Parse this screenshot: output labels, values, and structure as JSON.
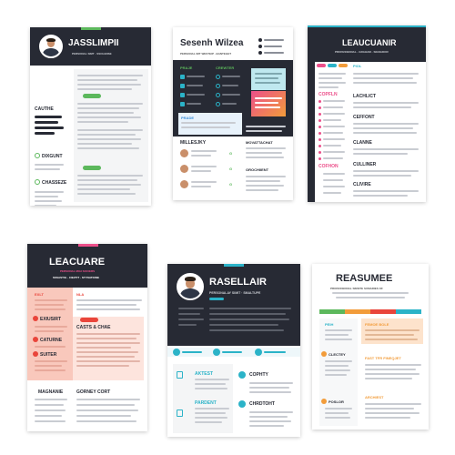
{
  "colors": {
    "dark": "#272a34",
    "green": "#5cb85c",
    "teal": "#2bb3c8",
    "pink": "#ec4f8a",
    "orange": "#f29c3a",
    "blue": "#3a8fd9",
    "peach": "#f9c8bc",
    "red": "#e9453b"
  },
  "resume1": {
    "name": "JASSLIMPII",
    "subtitle": "PERSONAL SIMT · SSOLENSE",
    "section_1": "CAUTHE",
    "section_2": "DIXGUNT",
    "section_3": "CHASSEZE"
  },
  "resume2": {
    "name": "Sesenh Wilzea",
    "subtitle": "PERSONAL IMT WESTEIP · BANTEGET",
    "col_1": "PRAJE",
    "col_2": "CREWTER",
    "col_3": "PRADE",
    "col_4": "EGATTEES",
    "col_5": "MILLESJKY",
    "col_6": "MOVATTACHAT",
    "col_7": "OROCHIIENT"
  },
  "resume3": {
    "name": "LEAUCUANIR",
    "subtitle": "PROFESSIONAL · GRAHAM · SIGNADOR",
    "sec_1": "COPFLN",
    "sec_2": "LACHLICT",
    "sec_3": "CEFFONT",
    "sec_4": "CLANNE",
    "sec_5": "COFHON",
    "sec_6": "CULLINER",
    "sec_7": "CLIVIRE"
  },
  "resume4": {
    "name": "LEACUARE",
    "subtitle": "PERSONAL MIAI SOCIERS",
    "subtitle_2": "SSSASTIG · CIEZTIT · STYNATIONE",
    "sec_1": "EXLT",
    "sec_2": "EXIUSIRT",
    "sec_3": "CASTS & CHAE",
    "sec_4": "CATURNE",
    "sec_5": "SUITER",
    "sec_6": "MAGNANIE",
    "sec_7": "GORNEY CORT"
  },
  "resume5": {
    "name": "RASELLAIR",
    "subtitle": "PERSONALAY SIMIT · SMALTUPE",
    "col_1": "AKTEST",
    "col_2": "COPHTY",
    "col_3": "PARDENT",
    "col_4": "CHRDTOHT"
  },
  "resume6": {
    "name": "REASUMEE",
    "subtitle": "PROFESSIONAL SINSITE SUMARIES OF",
    "sec_1": "PEIH",
    "sec_2": "CLECTEY",
    "sec_3": "POSLOR",
    "sec_4": "FEMOE BOLE",
    "sec_5": "FAST TFR FINEQJET",
    "sec_6": "ARCHIEST"
  }
}
